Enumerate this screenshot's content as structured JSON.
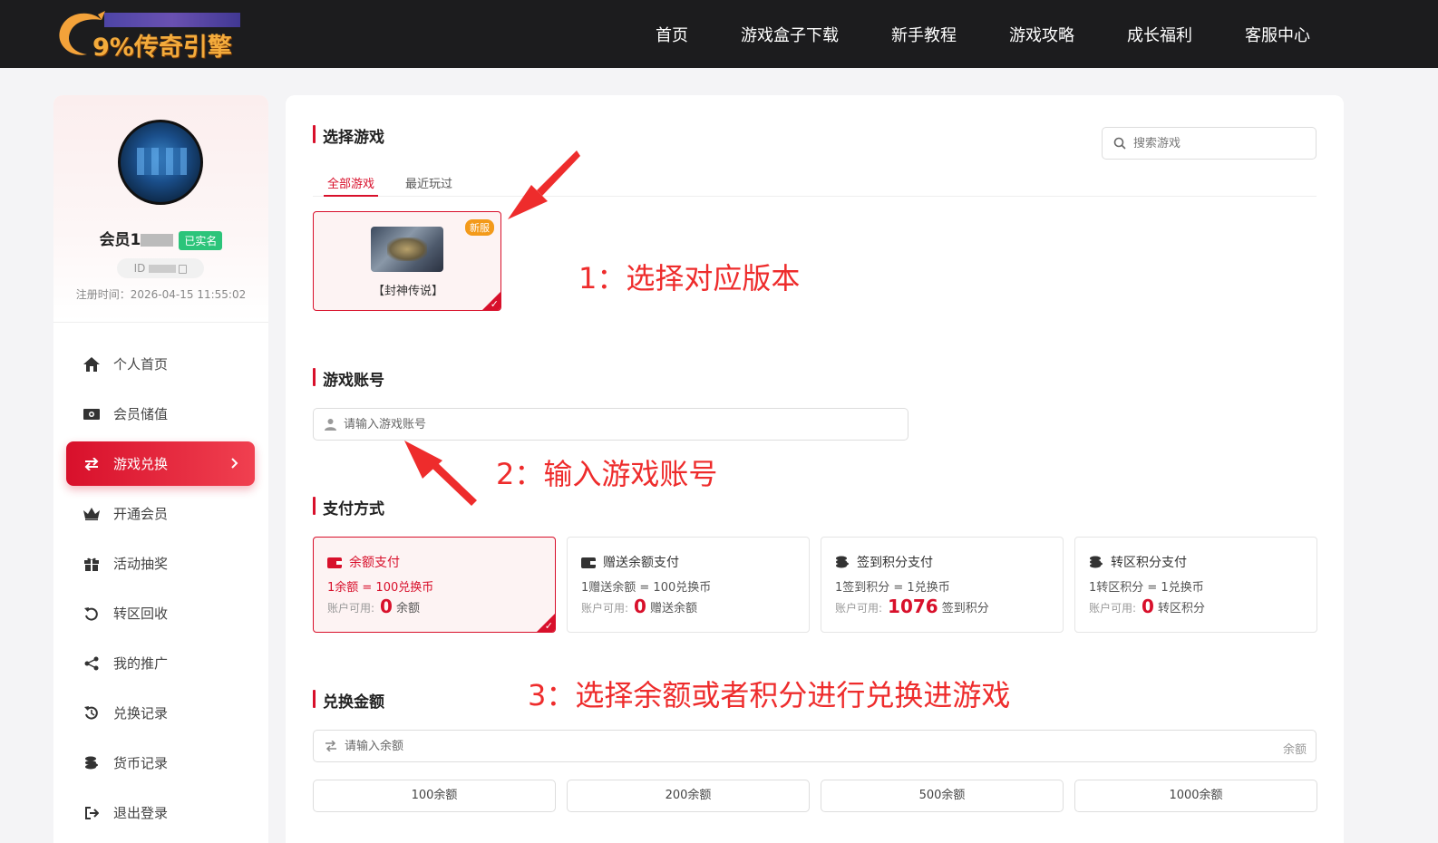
{
  "header": {
    "logo_text": "9%传奇引擎",
    "nav": [
      "首页",
      "游戏盒子下载",
      "新手教程",
      "游戏攻略",
      "成长福利",
      "客服中心"
    ]
  },
  "profile": {
    "member_name": "会员1",
    "verified_badge": "已实名",
    "id_label": "ID",
    "reg_time": "注册时间：2026-04-15 11:55:02"
  },
  "sidebar": {
    "items": [
      {
        "label": "个人首页",
        "icon": "home-icon"
      },
      {
        "label": "会员储值",
        "icon": "money-icon"
      },
      {
        "label": "游戏兑换",
        "icon": "exchange-icon"
      },
      {
        "label": "开通会员",
        "icon": "crown-icon"
      },
      {
        "label": "活动抽奖",
        "icon": "gift-icon"
      },
      {
        "label": "转区回收",
        "icon": "recycle-icon"
      },
      {
        "label": "我的推广",
        "icon": "share-icon"
      },
      {
        "label": "兑换记录",
        "icon": "history-icon"
      },
      {
        "label": "货币记录",
        "icon": "coins-icon"
      },
      {
        "label": "退出登录",
        "icon": "logout-icon"
      }
    ],
    "active": "游戏兑换"
  },
  "select_game": {
    "title": "选择游戏",
    "search_placeholder": "搜索游戏",
    "tabs": [
      "全部游戏",
      "最近玩过"
    ],
    "game": {
      "badge": "新服",
      "name": "【封神传说】"
    }
  },
  "account": {
    "title": "游戏账号",
    "placeholder": "请输入游戏账号"
  },
  "payment": {
    "title": "支付方式",
    "avail_label": "账户可用:",
    "methods": [
      {
        "name": "余额支付",
        "rate": "1余额 = 100兑换币",
        "value": "0",
        "unit": "余额"
      },
      {
        "name": "赠送余额支付",
        "rate": "1赠送余额 = 100兑换币",
        "value": "0",
        "unit": "赠送余额"
      },
      {
        "name": "签到积分支付",
        "rate": "1签到积分 = 1兑换币",
        "value": "1076",
        "unit": "签到积分"
      },
      {
        "name": "转区积分支付",
        "rate": "1转区积分 = 1兑换币",
        "value": "0",
        "unit": "转区积分"
      }
    ]
  },
  "amount": {
    "title": "兑换金额",
    "placeholder": "请输入余额",
    "suffix": "余额",
    "presets": [
      "100余额",
      "200余额",
      "500余额",
      "1000余额"
    ]
  },
  "annotations": {
    "step1": "1：选择对应版本",
    "step2": "2：输入游戏账号",
    "step3": "3：选择余额或者积分进行兑换进游戏"
  },
  "colors": {
    "accent": "#d8102b",
    "header_bg": "#1c1c1e",
    "annotation": "#ee2c2c",
    "verified": "#2cc47a",
    "badge": "#f39a1a"
  }
}
